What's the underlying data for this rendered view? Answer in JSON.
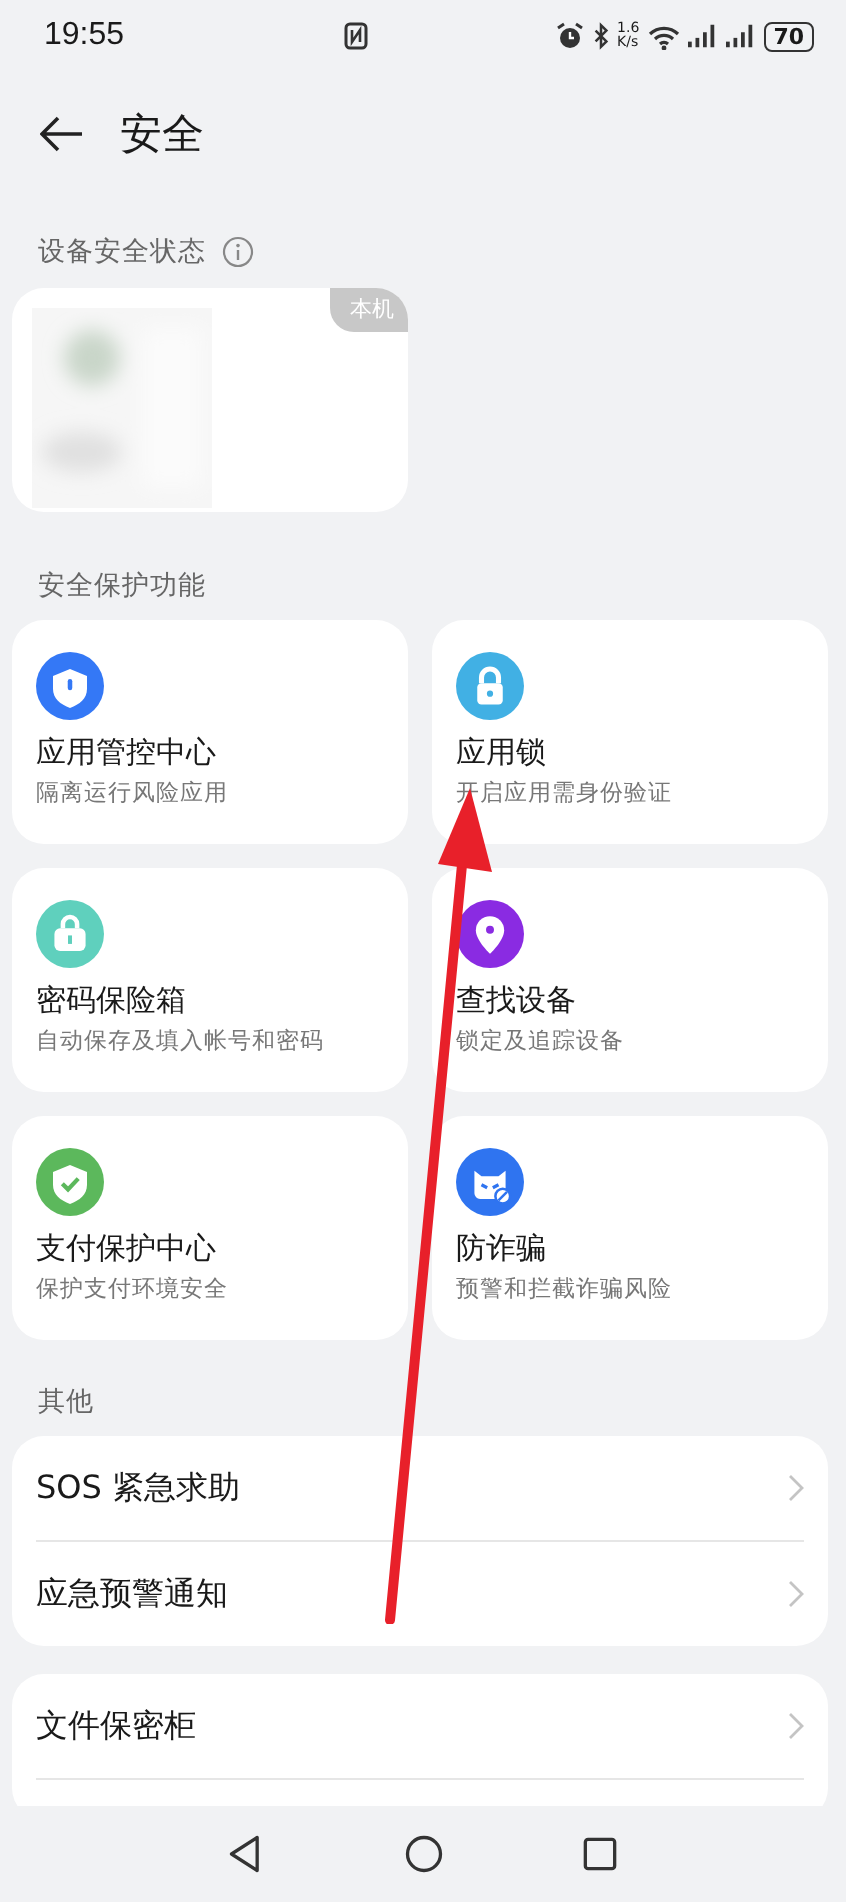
{
  "status_bar": {
    "time": "19:55",
    "speed_value": "1.6",
    "speed_unit": "K/s",
    "battery": "70"
  },
  "header": {
    "title": "安全"
  },
  "device_status": {
    "label": "设备安全状态",
    "badge": "本机"
  },
  "protection": {
    "label": "安全保护功能",
    "features": [
      {
        "title": "应用管控中心",
        "subtitle": "隔离运行风险应用",
        "kind": "shield",
        "color": "#3478f6"
      },
      {
        "title": "应用锁",
        "subtitle": "开启应用需身份验证",
        "kind": "lock",
        "color": "#41b0e4"
      },
      {
        "title": "密码保险箱",
        "subtitle": "自动保存及填入帐号和密码",
        "kind": "case",
        "color": "#5fd0bd"
      },
      {
        "title": "查找设备",
        "subtitle": "锁定及追踪设备",
        "kind": "pin",
        "color": "#8a2be2"
      },
      {
        "title": "支付保护中心",
        "subtitle": "保护支付环境安全",
        "kind": "check",
        "color": "#5cb85c"
      },
      {
        "title": "防诈骗",
        "subtitle": "预警和拦截诈骗风险",
        "kind": "cat",
        "color": "#2f74f0"
      }
    ]
  },
  "others": {
    "label": "其他",
    "groups": [
      [
        "SOS 紧急求助",
        "应急预警通知"
      ],
      [
        "文件保密柜"
      ]
    ]
  }
}
